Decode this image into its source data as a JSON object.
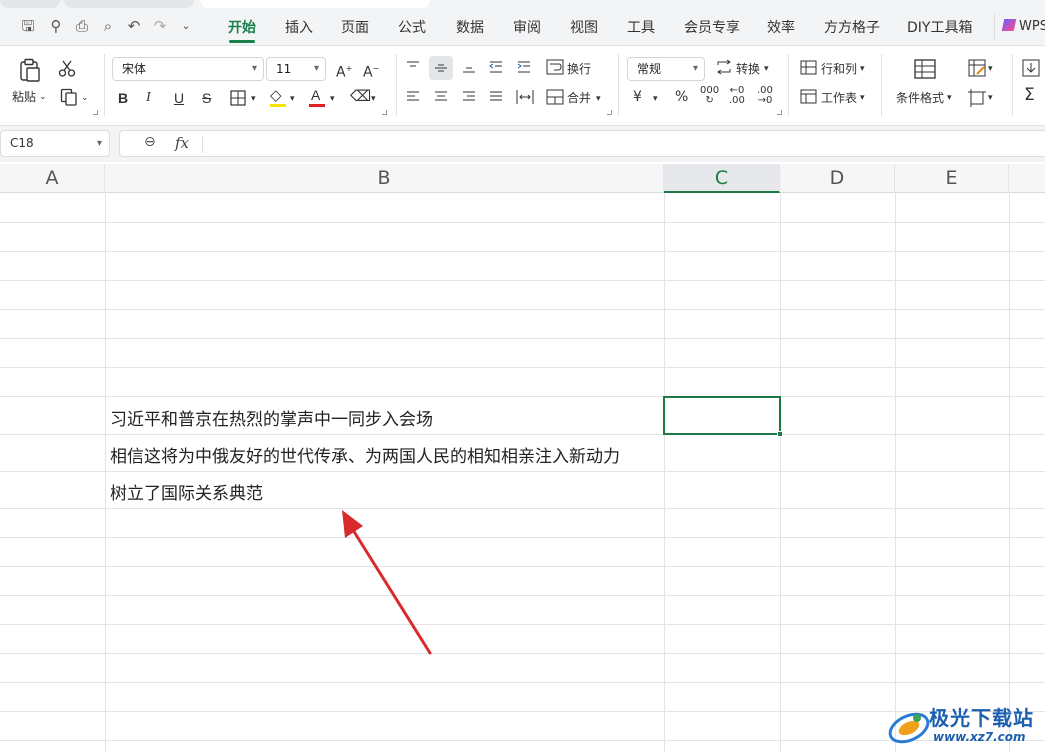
{
  "menu": {
    "tabs": [
      "开始",
      "插入",
      "页面",
      "公式",
      "数据",
      "审阅",
      "视图",
      "工具",
      "会员专享",
      "效率",
      "方方格子",
      "DIY工具箱"
    ],
    "brand": "WPS"
  },
  "ribbon": {
    "paste_label": "粘贴",
    "font_name": "宋体",
    "font_size": "11",
    "bold": "B",
    "italic": "I",
    "underline": "U",
    "strike": "S",
    "wrap_label": "换行",
    "merge_label": "合并",
    "number_format": "常规",
    "convert_label": "转换",
    "currency": "¥",
    "percent": "%",
    "rowcol_label": "行和列",
    "worksheet_label": "工作表",
    "cond_format_label": "条件格式",
    "font_color": "#e02020",
    "highlight_color": "#f5e400"
  },
  "formula_bar": {
    "name_box": "C18",
    "fx": "fx",
    "value": ""
  },
  "grid": {
    "columns": [
      "A",
      "B",
      "C",
      "D",
      "E"
    ],
    "selected_column": "C",
    "cells": [
      "习近平和普京在热烈的掌声中一同步入会场",
      "相信这将为中俄友好的世代传承、为两国人民的相知相亲注入新动力",
      "树立了国际关系典范"
    ]
  },
  "watermark": {
    "title": "极光下载站",
    "url": "www.xz7.com"
  },
  "colors": {
    "accent": "#1d7a46",
    "arrow": "#d92b2b"
  }
}
